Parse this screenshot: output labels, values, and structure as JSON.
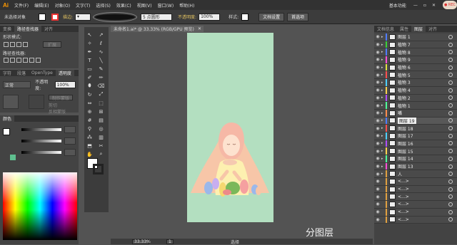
{
  "menu": {
    "app": "Ai",
    "items": [
      "文件(F)",
      "编辑(E)",
      "对象(O)",
      "文字(T)",
      "选择(S)",
      "效果(C)",
      "视图(V)",
      "窗口(W)",
      "帮助(H)"
    ],
    "workspace": "基本功能"
  },
  "control": {
    "selection": "未选择对象",
    "stroke_label": "描边:",
    "stroke_width": "5 点圆形",
    "opacity_label": "不透明度:",
    "opacity": "100%",
    "style_label": "样式:",
    "doc_setup": "文档设置",
    "prefs": "首选项"
  },
  "tab": {
    "title": "未命名1.ai* @ 33.33% (RGB/GPU 预览)"
  },
  "left": {
    "tabs": [
      "变换",
      "路径查找器",
      "对齐"
    ],
    "shape_modes": "形状模式:",
    "expand": "扩展",
    "pathfinders": "路径查找器:",
    "tabs2": [
      "字符",
      "段落",
      "OpenType",
      "透明度"
    ],
    "mode": "正常",
    "opacity_label": "不透明度:",
    "opacity": "100%",
    "make_mask": "制作蒙版",
    "clip": "剪切",
    "invert": "反相蒙版",
    "color_tab": "颜色"
  },
  "layers": {
    "tabs": [
      "文档信息",
      "属性",
      "图层",
      "对齐"
    ],
    "rows": [
      {
        "name": "图层 1",
        "color": "#4f7cff"
      },
      {
        "name": "植物 7",
        "color": "#3ad13a"
      },
      {
        "name": "植物 8",
        "color": "#4f7cff"
      },
      {
        "name": "植物 9",
        "color": "#ff4fd8"
      },
      {
        "name": "植物 6",
        "color": "#e0e040"
      },
      {
        "name": "植物 5",
        "color": "#ff4f4f"
      },
      {
        "name": "植物 3",
        "color": "#4fd0ff"
      },
      {
        "name": "植物 4",
        "color": "#ffd24f"
      },
      {
        "name": "植物 2",
        "color": "#b04fff"
      },
      {
        "name": "植物 1",
        "color": "#4fff9a"
      },
      {
        "name": "嘴",
        "color": "#ff8c4f"
      },
      {
        "name": "图层 19",
        "color": "#4f7cff",
        "editing": true
      },
      {
        "name": "图层 18",
        "color": "#ff4f4f"
      },
      {
        "name": "图层 17",
        "color": "#4fd0ff"
      },
      {
        "name": "图层 16",
        "color": "#b04fff"
      },
      {
        "name": "图层 15",
        "color": "#ffd24f"
      },
      {
        "name": "图层 14",
        "color": "#4fff9a"
      },
      {
        "name": "图层 13",
        "color": "#ff4fd8"
      },
      {
        "name": "人",
        "color": "#e0a040"
      },
      {
        "name": "<...>",
        "color": "#e0a040"
      },
      {
        "name": "<...>",
        "color": "#e0a040"
      },
      {
        "name": "<...>",
        "color": "#e0a040"
      },
      {
        "name": "<...>",
        "color": "#e0a040"
      },
      {
        "name": "<...>",
        "color": "#e0a040"
      },
      {
        "name": "<...>",
        "color": "#e0a040"
      }
    ]
  },
  "status": {
    "zoom": "33.33%",
    "page": "1",
    "tool": "选择"
  },
  "watermark": "分图层",
  "colors": {
    "artboard": "#b3dfc0",
    "accent": "#ff9a00"
  }
}
